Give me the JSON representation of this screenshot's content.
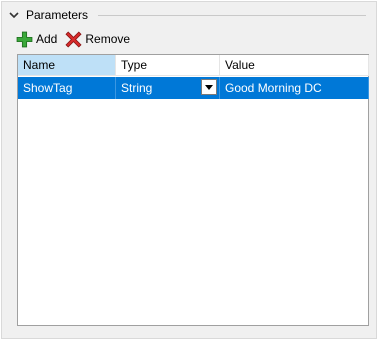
{
  "group": {
    "title": "Parameters",
    "toggle_icon": "chevron-down-icon"
  },
  "toolbar": {
    "add_label": "Add",
    "add_icon": "green-plus-icon",
    "remove_label": "Remove",
    "remove_icon": "red-x-icon"
  },
  "grid": {
    "columns": [
      "Name",
      "Type",
      "Value"
    ],
    "rows": [
      {
        "name": "ShowTag",
        "type": "String",
        "value": "Good Morning DC",
        "selected": true
      }
    ]
  },
  "colors": {
    "selection": "#0078d7",
    "header_sorted": "#bee0f7",
    "background": "#f0f0f0"
  }
}
